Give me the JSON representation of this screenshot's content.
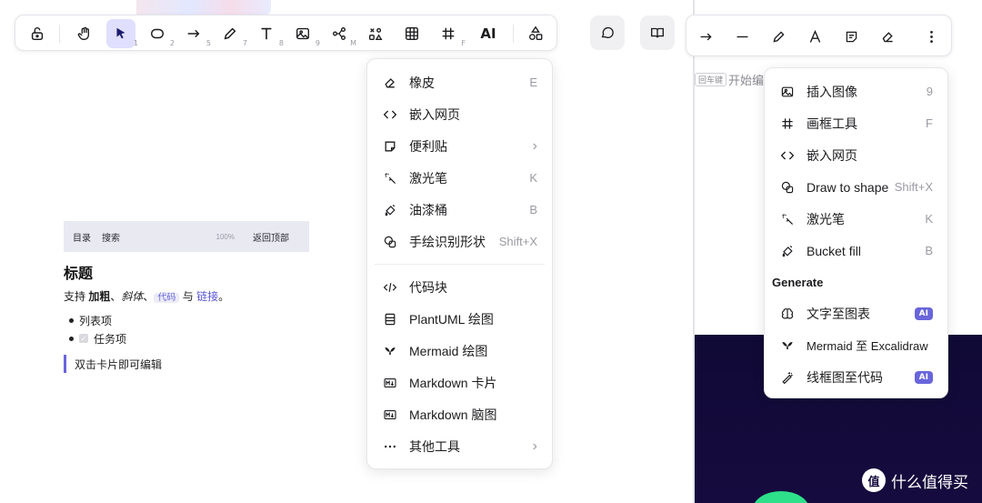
{
  "toolbar": {
    "keys": {
      "select": "1",
      "rect": "2",
      "arrow": "5",
      "pencil": "7",
      "text": "8",
      "image": "9",
      "mindmap": "M",
      "frame": "F"
    },
    "ai_label": "AI"
  },
  "menu_left": {
    "items": [
      {
        "label": "橡皮",
        "key": "E"
      },
      {
        "label": "嵌入网页",
        "key": ""
      },
      {
        "label": "便利贴",
        "key": ""
      },
      {
        "label": "激光笔",
        "key": "K"
      },
      {
        "label": "油漆桶",
        "key": "B"
      },
      {
        "label": "手绘识别形状",
        "key": "Shift+X"
      },
      {
        "label": "代码块",
        "key": ""
      },
      {
        "label": "PlantUML 绘图",
        "key": ""
      },
      {
        "label": "Mermaid 绘图",
        "key": ""
      },
      {
        "label": "Markdown 卡片",
        "key": ""
      },
      {
        "label": "Markdown 脑图",
        "key": ""
      },
      {
        "label": "其他工具",
        "key": ""
      }
    ]
  },
  "menu_right": {
    "items": [
      {
        "label": "插入图像",
        "key": "9"
      },
      {
        "label": "画框工具",
        "key": "F"
      },
      {
        "label": "嵌入网页",
        "key": ""
      },
      {
        "label": "Draw to shape",
        "key": "Shift+X"
      },
      {
        "label": "激光笔",
        "key": "K"
      },
      {
        "label": "Bucket fill",
        "key": "B"
      }
    ],
    "section_title": "Generate",
    "generate": [
      {
        "label": "文字至图表",
        "badge": "AI"
      },
      {
        "label": "Mermaid 至 Excalidraw",
        "badge": ""
      },
      {
        "label": "线框图至代码",
        "badge": "AI"
      }
    ]
  },
  "md_card": {
    "nav_toc": "目录",
    "nav_search": "搜索",
    "zoom": "100%",
    "back_top": "返回顶部",
    "title": "标题",
    "line_prefix": "支持 ",
    "bold": "加粗",
    "sep1": "、",
    "italic": "斜体",
    "sep2": "、",
    "code": "代码",
    "with": " 与 ",
    "link": "链接",
    "end": "。",
    "list_item": "列表项",
    "task_item": "任务项",
    "quote": "双击卡片即可编辑"
  },
  "hint": {
    "kbd": "回车键",
    "text": "开始编"
  },
  "watermark": {
    "logo": "值",
    "text": "什么值得买"
  },
  "colors": {
    "accent": "#6965db",
    "active_bg": "#e0dfff",
    "dark_bg": "#120b3a",
    "green": "#2ee08a"
  }
}
